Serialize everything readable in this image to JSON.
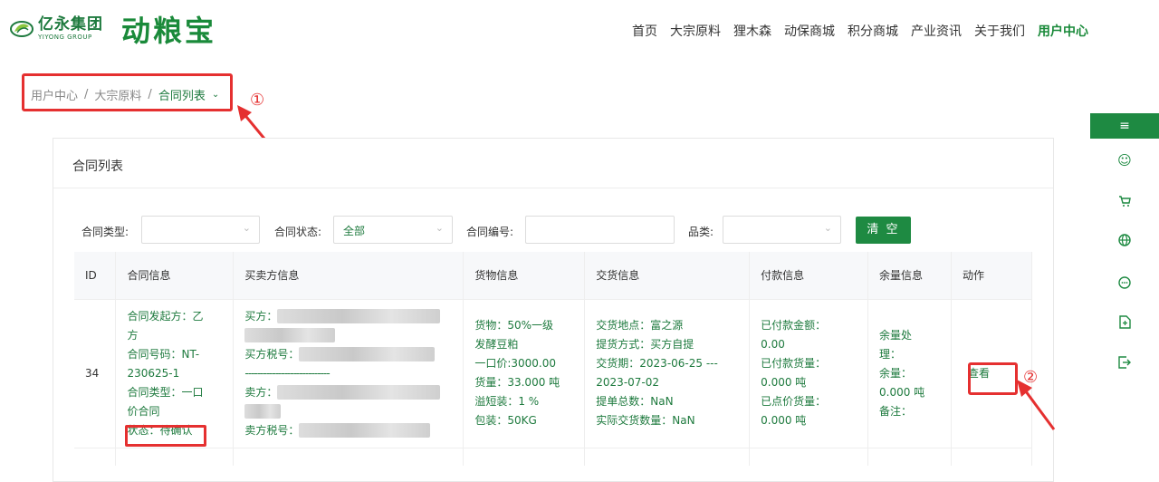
{
  "brand": {
    "company_cn": "亿永集团",
    "company_en": "YIYONG GROUP",
    "product": "动粮宝"
  },
  "nav": {
    "items": [
      "首页",
      "大宗原料",
      "狸木森",
      "动保商城",
      "积分商城",
      "产业资讯",
      "关于我们",
      "用户中心"
    ]
  },
  "breadcrumb": {
    "items": [
      "用户中心",
      "大宗原料",
      "合同列表"
    ],
    "sep": "/"
  },
  "annotations": {
    "one": "①",
    "two": "②"
  },
  "card": {
    "title": "合同列表"
  },
  "filters": {
    "type_label": "合同类型:",
    "status_label": "合同状态:",
    "status_value": "全部",
    "number_label": "合同编号:",
    "category_label": "品类:",
    "clear_label": "清 空"
  },
  "table": {
    "headers": [
      "ID",
      "合同信息",
      "买卖方信息",
      "货物信息",
      "交货信息",
      "付款信息",
      "余量信息",
      "动作"
    ],
    "row": {
      "id": "34",
      "contract": [
        "合同发起方：乙",
        "方",
        "合同号码：NT-",
        "230625-1",
        "合同类型：一口",
        "价合同",
        "状态：待确认"
      ],
      "parties": {
        "buyer": "买方：",
        "buyer_tax": "买方税号：",
        "dashes": "----------------------------",
        "seller": "卖方：",
        "seller_tax": "卖方税号："
      },
      "goods": [
        "货物：50%一级",
        "发酵豆粕",
        "一口价:3000.00",
        "货量：33.000 吨",
        "溢短装：1 %",
        "包装：50KG"
      ],
      "delivery": [
        "交货地点：富之源",
        "提货方式：买方自提",
        "交货期：2023-06-25 ---",
        "2023-07-02",
        "提单总数：NaN",
        "实际交货数量：NaN"
      ],
      "payment": [
        "已付款金额：",
        "0.00",
        "已付款货量：",
        "0.000 吨",
        "已点价货量：",
        "0.000 吨"
      ],
      "remain": [
        "余量处",
        "理：",
        "余量：",
        "0.000 吨",
        "备注："
      ],
      "action": "查看"
    }
  },
  "sidebar": {
    "icons": [
      "menu-icon",
      "user-icon",
      "cart-icon",
      "globe-icon",
      "chat-icon",
      "document-icon",
      "exit-icon"
    ]
  },
  "colors": {
    "brand_green": "#1e8a42",
    "annotation_red": "#e53030"
  }
}
